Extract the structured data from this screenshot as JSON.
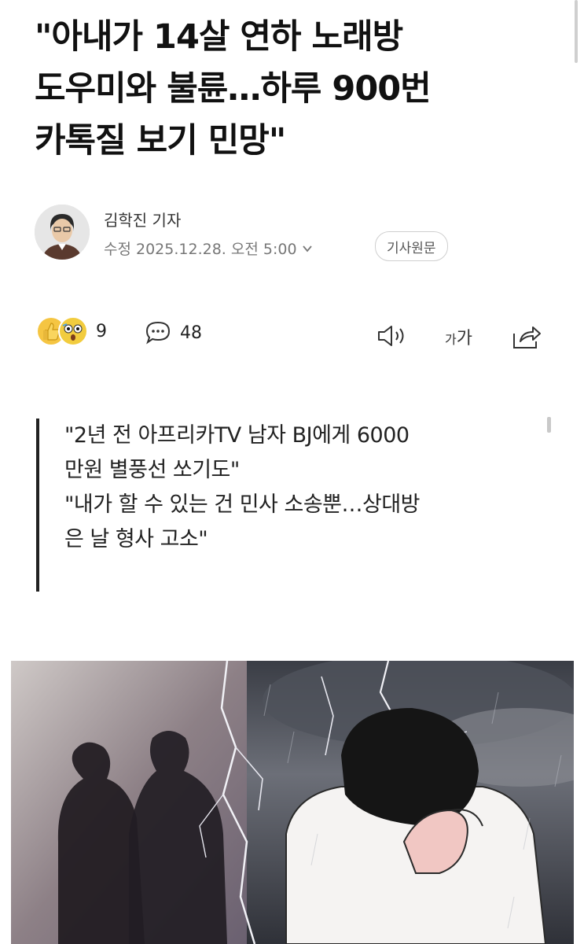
{
  "article": {
    "title_lines": [
      "\"아내가 14살 연하 노래방",
      "도우미와 불륜…하루 900번",
      "카톡질 보기 민망\""
    ]
  },
  "byline": {
    "author": "김학진 기자",
    "date": "수정 2025.12.28. 오전 5:00",
    "source_button": "기사원문"
  },
  "actions": {
    "reaction_count": "9",
    "comment_count": "48",
    "font_size_label_small": "가",
    "font_size_label_large": "가",
    "icons": [
      "thumbs-up-icon",
      "surprised-face-icon",
      "comment-icon",
      "speaker-icon",
      "share-icon"
    ]
  },
  "summary": {
    "lines": [
      "\"2년 전 아프리카TV 남자 BJ에게 6000",
      "만원 별풍선 쏘기도\"",
      "\"내가 할 수 있는 건 민사 소송뿐…상대방",
      "은 날 형사 고소\""
    ]
  },
  "colors": {
    "text": "#111111",
    "muted": "#777777",
    "border": "#cfcfcf"
  }
}
